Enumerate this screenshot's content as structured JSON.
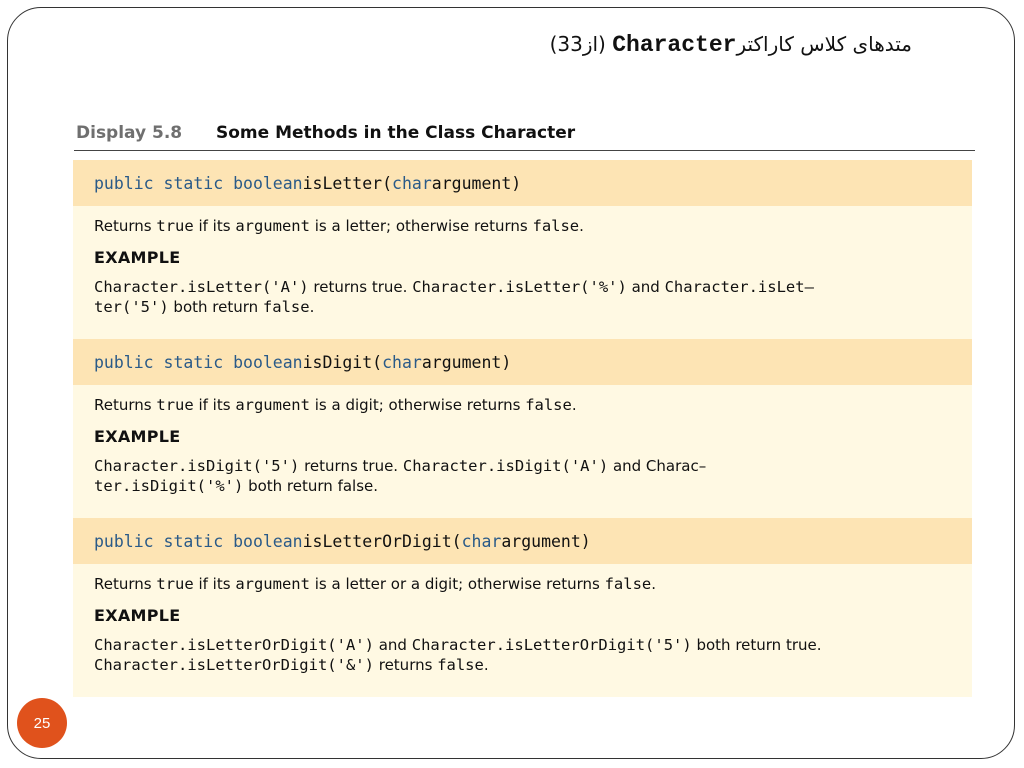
{
  "title": {
    "paren": "(3از3)",
    "code": "Character",
    "text": "متدهای کلاس کاراکتر"
  },
  "display": {
    "label": "Display 5.8",
    "caption": "Some Methods in the Class Character"
  },
  "methods": [
    {
      "sig": {
        "p1": "public static boolean ",
        "name": "isLetter(",
        "kw": "char",
        "rest": " argument)"
      },
      "desc": {
        "a": "Returns ",
        "b": "true",
        "c": " if its ",
        "d": "argument",
        "e": " is a letter; otherwise returns ",
        "f": "false",
        "g": "."
      },
      "example_label": "EXAMPLE",
      "ex1": {
        "a": "Character.isLetter('A')",
        "b": " returns true. ",
        "c": "Character.isLetter('%')",
        "d": " and ",
        "e": "Character.isLet–"
      },
      "ex2": {
        "a": "ter('5')",
        "b": " both return ",
        "c": "false",
        "d": "."
      }
    },
    {
      "sig": {
        "p1": "public static boolean ",
        "name": "isDigit(",
        "kw": "char",
        "rest": " argument)"
      },
      "desc": {
        "a": "Returns ",
        "b": "true",
        "c": " if its ",
        "d": "argument",
        "e": " is a digit; otherwise returns ",
        "f": "false",
        "g": "."
      },
      "example_label": "EXAMPLE",
      "ex1": {
        "a": "Character.isDigit('5')",
        "b": " returns true. ",
        "c": "Character.isDigit('A')",
        "d": " and Charac–",
        "e": ""
      },
      "ex2": {
        "a": "ter.isDigit('%')",
        "b": " both return false.",
        "c": "",
        "d": ""
      }
    },
    {
      "sig": {
        "p1": "public static boolean ",
        "name": "isLetterOrDigit(",
        "kw": "char",
        "rest": " argument)"
      },
      "desc": {
        "a": "Returns ",
        "b": "true",
        "c": " if its ",
        "d": "argument",
        "e": " is a letter or a digit; otherwise returns ",
        "f": "false",
        "g": "."
      },
      "example_label": "EXAMPLE",
      "ex1": {
        "a": "Character.isLetterOrDigit('A')",
        "b": " and ",
        "c": "Character.isLetterOrDigit('5')",
        "d": " both return ",
        "e": "true."
      },
      "ex2": {
        "a": "Character.isLetterOrDigit('&')",
        "b": " returns ",
        "c": "false",
        "d": "."
      }
    }
  ],
  "page_number": "25",
  "colors": {
    "signature_bg": "#fde4b4",
    "body_bg": "#fff9e3",
    "keyword": "#2a5a88",
    "badge": "#e0521c"
  }
}
